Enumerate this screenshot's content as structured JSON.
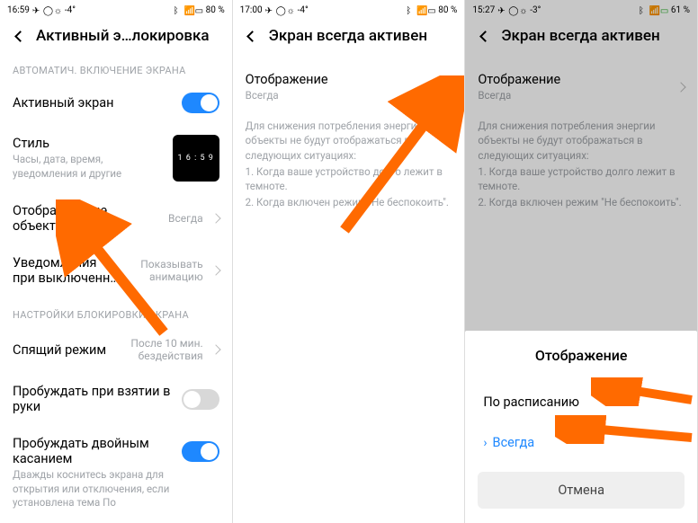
{
  "p1": {
    "status": {
      "time": "16:59",
      "temp": "-4°",
      "battery": "80 %"
    },
    "header": "Активный э…локировка",
    "sec1": "АВТОМАТИЧ. ВКЛЮЧЕНИЕ ЭКРАНА",
    "r1": {
      "title": "Активный экран"
    },
    "r2": {
      "title": "Стиль",
      "sub": "Часы, дата, время, уведомления и другие",
      "preview": "1 6 : 5 9"
    },
    "r3": {
      "title": "Отображаемые объекты",
      "val": "Всегда"
    },
    "r4": {
      "title": "Уведомления при выключенн…",
      "val": "Показывать анимацию"
    },
    "sec2": "НАСТРОЙКИ БЛОКИРОВКИ ЭКРАНА",
    "r5": {
      "title": "Спящий режим",
      "val": "После 10 мин. бездействия"
    },
    "r6": {
      "title": "Пробуждать при взятии в руки"
    },
    "r7": {
      "title": "Пробуждать двойным касанием",
      "sub": "Дважды коснитесь экрана для открытия или отключения, если установлена тема По"
    }
  },
  "p2": {
    "status": {
      "time": "17:00",
      "temp": "-4°",
      "battery": "80 %"
    },
    "header": "Экран всегда активен",
    "r1": {
      "title": "Отображение",
      "sub": "Всегда"
    },
    "info": {
      "l1": "Для снижения потребления энергии объекты не будут отображаться в следующих ситуациях:",
      "l2": "1. Когда ваше устройство долго лежит в темноте.",
      "l3": "2. Когда включен режим \"Не беспокоить\"."
    }
  },
  "p3": {
    "status": {
      "time": "15:27",
      "temp": "-3°",
      "battery": "61 %"
    },
    "header": "Экран всегда активен",
    "r1": {
      "title": "Отображение",
      "sub": "Всегда"
    },
    "info": {
      "l1": "Для снижения потребления энергии объекты не будут отображаться в следующих ситуациях:",
      "l2": "1. Когда ваше устройство долго лежит в темноте.",
      "l3": "2. Когда включен режим \"Не беспокоить\"."
    },
    "sheet": {
      "title": "Отображение",
      "opt1": "По расписанию",
      "opt2": "Всегда",
      "cancel": "Отмена"
    }
  }
}
